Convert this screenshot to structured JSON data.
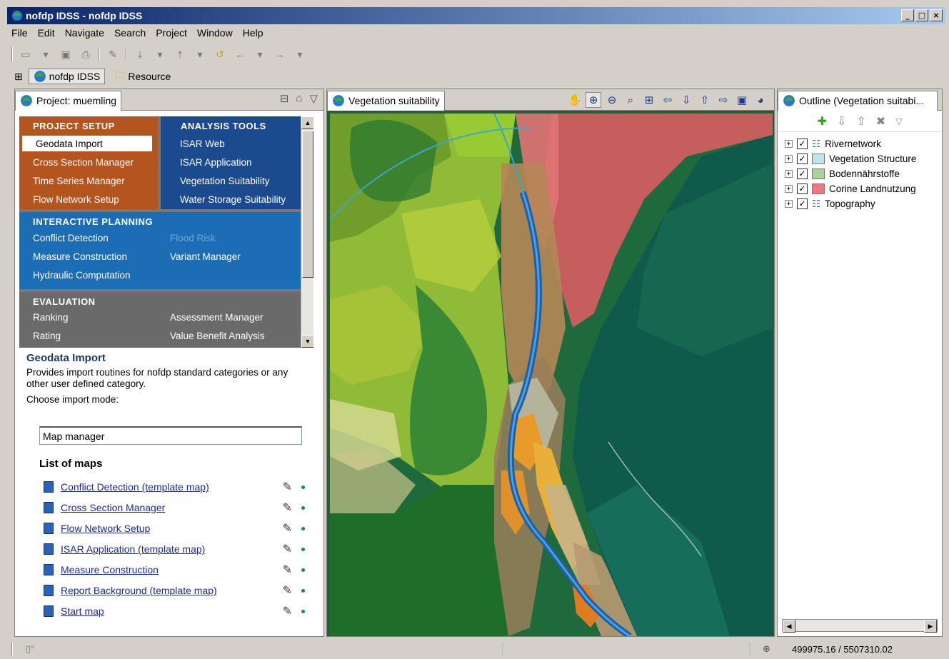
{
  "window": {
    "title": "nofdp IDSS - nofdp IDSS",
    "controls": [
      "_",
      "□",
      "×"
    ]
  },
  "menubar": {
    "items": [
      "File",
      "Edit",
      "Navigate",
      "Search",
      "Project",
      "Window",
      "Help"
    ]
  },
  "perspectives": [
    {
      "label": "nofdp IDSS",
      "active": true
    },
    {
      "label": "Resource",
      "active": false
    }
  ],
  "project_view": {
    "tab_label": "Project: muemling",
    "sections": {
      "project_setup": {
        "title": "PROJECT SETUP",
        "items": [
          "Geodata Import",
          "Cross Section Manager",
          "Time Series Manager",
          "Flow Network Setup"
        ]
      },
      "analysis_tools": {
        "title": "ANALYSIS TOOLS",
        "items": [
          "ISAR Web",
          "ISAR Application",
          "Vegetation Suitability",
          "Water Storage Suitability"
        ]
      },
      "interactive_planning": {
        "title": "INTERACTIVE PLANNING",
        "left_items": [
          "Conflict Detection",
          "Measure Construction",
          "Hydraulic Computation"
        ],
        "right_items": [
          "Flood Risk",
          "Variant Manager"
        ]
      },
      "evaluation": {
        "title": "EVALUATION",
        "left_items": [
          "Ranking",
          "Rating"
        ],
        "right_items": [
          "Assessment Manager",
          "Value Benefit Analysis"
        ]
      }
    },
    "description": {
      "title": "Geodata Import",
      "text": "Provides import routines for nofdp standard categories or any other user defined category.",
      "mode_label": "Choose import mode:",
      "mode_value": "Map manager"
    },
    "maps_title": "List of maps",
    "maps": [
      "Conflict Detection (template map)",
      "Cross Section Manager",
      "Flow Network Setup",
      "ISAR Application (template map)",
      "Measure Construction",
      "Report Background (template map)",
      "Start map"
    ]
  },
  "map_view": {
    "tab_label": "Vegetation suitability"
  },
  "outline_view": {
    "tab_label": "Outline (Vegetation suitabi...",
    "layers": [
      {
        "name": "Rivernetwork",
        "checked": true,
        "swatch": "",
        "kind": "list"
      },
      {
        "name": "Vegetation Structure",
        "checked": true,
        "swatch": "#bfe4ea",
        "kind": "swatch"
      },
      {
        "name": "Bodennährstoffe",
        "checked": true,
        "swatch": "#a8d49a",
        "kind": "swatch"
      },
      {
        "name": "Corine Landnutzung",
        "checked": true,
        "swatch": "#f07880",
        "kind": "swatch"
      },
      {
        "name": "Topography",
        "checked": true,
        "swatch": "",
        "kind": "list"
      }
    ]
  },
  "statusbar": {
    "coords": "499975.16 / 5507310.02"
  },
  "colors": {
    "project_setup": "#b45520",
    "analysis_tools": "#1b4a8e",
    "interactive_planning": "#1c6db4",
    "evaluation": "#6a6a6a"
  }
}
